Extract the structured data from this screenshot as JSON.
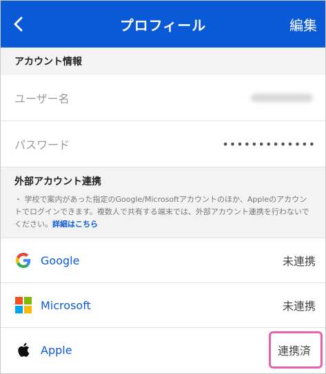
{
  "header": {
    "title": "プロフィール",
    "edit_label": "編集"
  },
  "account": {
    "section_title": "アカウント情報",
    "username_label": "ユーザー名",
    "password_label": "パスワード",
    "password_value": "•••••••••••••"
  },
  "external": {
    "section_title": "外部アカウント連携",
    "description": "・ 学校で案内があった指定のGoogle/Microsoftアカウントのほか、Appleのアカウントでログインできます。複数人で共有する端末では、外部アカウント連携を行わないでください。",
    "link_label": "詳細はこちら",
    "providers": [
      {
        "name": "Google",
        "status": "未連携",
        "icon": "google-icon"
      },
      {
        "name": "Microsoft",
        "status": "未連携",
        "icon": "microsoft-icon"
      },
      {
        "name": "Apple",
        "status": "連携済",
        "icon": "apple-icon"
      }
    ]
  },
  "colors": {
    "nav_background": "#0a5ad8",
    "link_blue": "#0a5ad8",
    "highlight_pink": "#e463a9"
  }
}
